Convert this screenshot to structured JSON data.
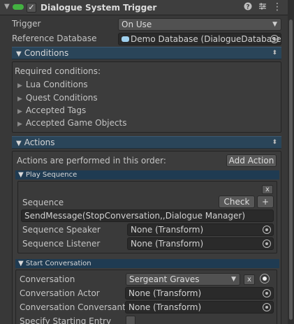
{
  "component": {
    "title": "Dialogue System Trigger",
    "enabled_checkmark": "✓",
    "icons": [
      "help-icon",
      "presets-icon",
      "menu-icon"
    ]
  },
  "fields": {
    "trigger_label": "Trigger",
    "trigger_value": "On Use",
    "reference_db_label": "Reference Database",
    "reference_db_value": "Demo Database (DialogueDatabase"
  },
  "conditions": {
    "header": "Conditions",
    "required_label": "Required conditions:",
    "items": [
      "Lua Conditions",
      "Quest Conditions",
      "Accepted Tags",
      "Accepted Game Objects"
    ]
  },
  "actions": {
    "header": "Actions",
    "order_label": "Actions are performed in this order:",
    "add_action_label": "Add Action",
    "play_sequence": {
      "header": "Play Sequence",
      "remove_label": "x",
      "sequence_label": "Sequence",
      "check_label": "Check",
      "plus_label": "+",
      "sequence_value": "SendMessage(StopConversation,,Dialogue Manager)",
      "speaker_label": "Sequence Speaker",
      "speaker_value": "None (Transform)",
      "listener_label": "Sequence Listener",
      "listener_value": "None (Transform)"
    },
    "start_conversation": {
      "header": "Start Conversation",
      "conversation_label": "Conversation",
      "conversation_value": "Sergeant Graves",
      "clear_label": "x",
      "actor_label": "Conversation Actor",
      "actor_value": "None (Transform)",
      "conversant_label": "Conversation Conversant",
      "conversant_value": "None (Transform)",
      "starting_entry_label": "Specify Starting Entry"
    }
  },
  "colors": {
    "background": "#383838",
    "foldout_header": "#2a4559",
    "subheader": "#1f3b52",
    "script_icon": "#43b141"
  }
}
